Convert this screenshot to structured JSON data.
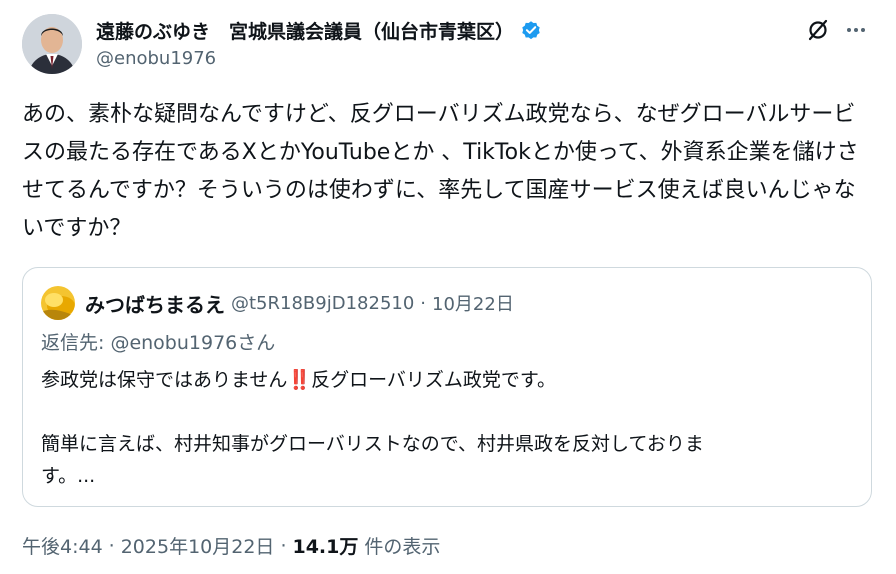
{
  "author": {
    "display_name": "遠藤のぶゆき　宮城県議会議員（仙台市青葉区）",
    "handle": "@enobu1976",
    "verified": true,
    "verified_color": "#1d9bf0"
  },
  "tweet": {
    "text": "あの、素朴な疑問なんですけど、反グローバリズム政党なら、なぜグローバルサービスの最たる存在であるXとかYouTubeとか 、TikTokとか使って、外資系企業を儲けさせてるんですか？そういうのは使わずに、率先して国産サービス使えば良いんじゃないですか？"
  },
  "quote": {
    "display_name": "みつばちまるえ",
    "handle": "@t5R18B9jD182510",
    "separator": "·",
    "date": "10月22日",
    "reply_prefix": "返信先: ",
    "reply_mention": "@enobu1976",
    "reply_suffix": "さん",
    "line1_before": "参政党は保守ではありません",
    "line1_emoji": "‼️",
    "line1_after": "反グローバリズム政党です。",
    "line2": "簡単に言えば、村井知事がグローバリストなので、村井県政を反対しておりま",
    "line3": "す。..."
  },
  "meta": {
    "time": "午後4:44",
    "separator": "·",
    "date": "2025年10月22日",
    "views_count": "14.1万",
    "views_label": "件の表示"
  },
  "icons": {
    "grok": "grok-icon",
    "more": "more-icon",
    "verified": "verified-badge-icon"
  }
}
